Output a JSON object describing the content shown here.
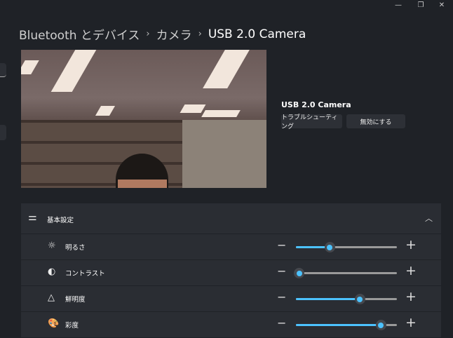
{
  "window": {
    "minimize": "—",
    "maximize": "❐",
    "close": "✕"
  },
  "breadcrumb": {
    "items": [
      "Bluetooth とデバイス",
      "カメラ",
      "USB 2.0 Camera"
    ],
    "separator": "›"
  },
  "device": {
    "name": "USB 2.0 Camera",
    "troubleshoot_label": "トラブルシューティング",
    "disable_label": "無効にする"
  },
  "settings": {
    "section_title": "基本設定",
    "section_icon": "sliders-icon",
    "accent": "#4cc2ff",
    "rows": [
      {
        "label": "明るさ",
        "icon": "sun-icon",
        "glyph": "☼",
        "value": 0.33
      },
      {
        "label": "コントラスト",
        "icon": "contrast-icon",
        "glyph": "◐",
        "value": 0.03
      },
      {
        "label": "鮮明度",
        "icon": "sharpness-icon",
        "glyph": "△",
        "value": 0.63
      },
      {
        "label": "彩度",
        "icon": "palette-icon",
        "glyph": "🎨",
        "value": 0.84
      }
    ],
    "minus": "−",
    "plus": "+"
  }
}
